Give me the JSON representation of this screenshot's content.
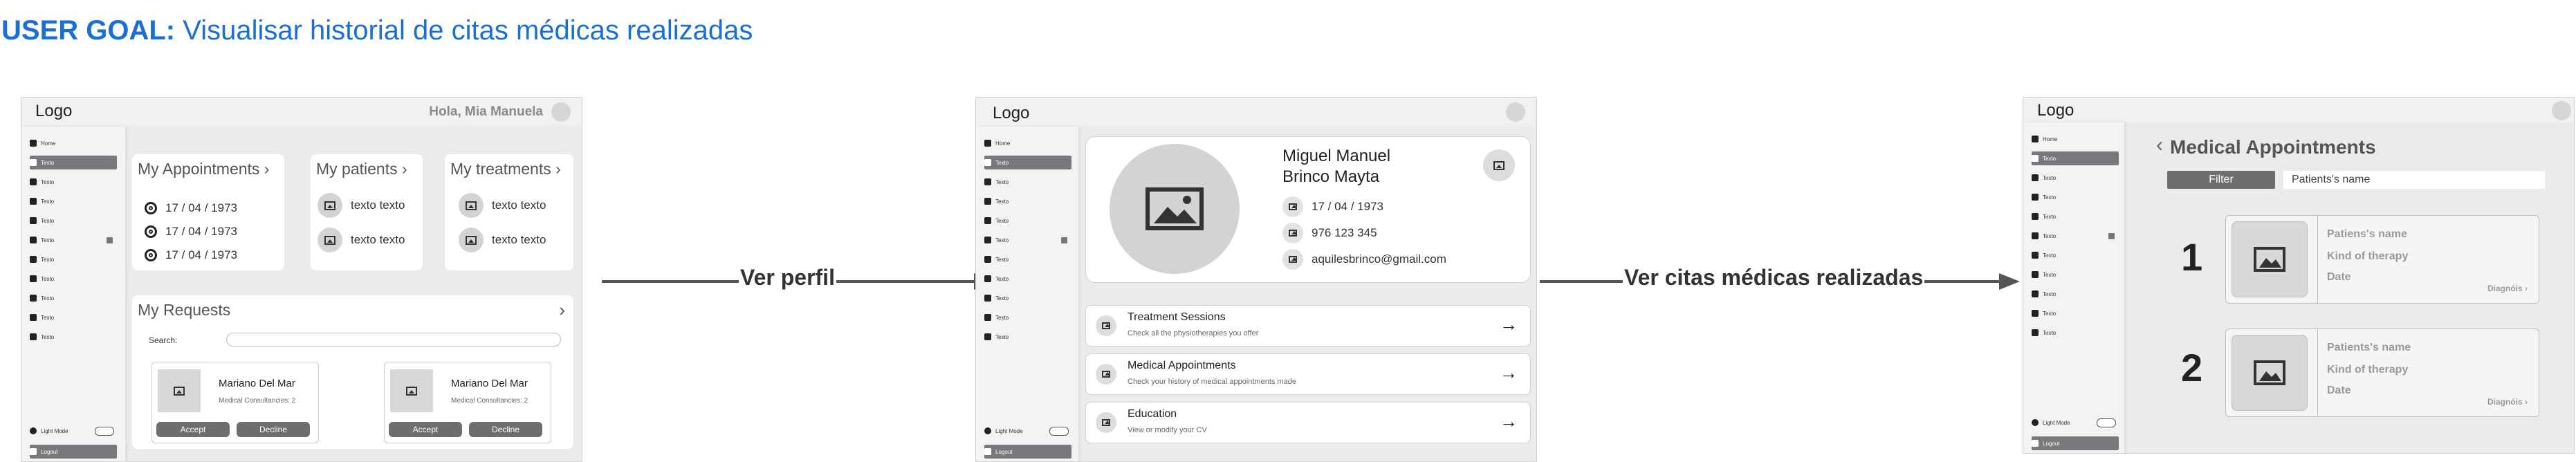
{
  "goal": {
    "prefix": "USER GOAL:",
    "text": "Visualisar historial de citas médicas realizadas"
  },
  "sidebar_generic": {
    "item_label": "Texto",
    "first_label": "Home",
    "lightmode": "Light Mode",
    "logout": "Logout"
  },
  "screen1": {
    "logo": "Logo",
    "greeting": "Hola, Mia Manuela",
    "appointments": {
      "title": "My Appointments ›",
      "dates": [
        "17 / 04 / 1973",
        "17 / 04 / 1973",
        "17 / 04 / 1973"
      ]
    },
    "patients": {
      "title": "My patients ›",
      "items": [
        "texto texto",
        "texto texto"
      ]
    },
    "treatments": {
      "title": "My treatments ›",
      "items": [
        "texto texto",
        "texto texto"
      ]
    },
    "requests": {
      "title": "My Requests",
      "chevron": "›",
      "search_label": "Search:",
      "cards": [
        {
          "name": "Mariano Del Mar",
          "sub": "Medical Consultancies: 2",
          "accept": "Accept",
          "decline": "Decline"
        },
        {
          "name": "Mariano Del Mar",
          "sub": "Medical Consultancies: 2",
          "accept": "Accept",
          "decline": "Decline"
        }
      ]
    }
  },
  "arrow1": {
    "label": "Ver perfil"
  },
  "screen2": {
    "logo": "Logo",
    "profile": {
      "name_line1": "Miguel Manuel",
      "name_line2": "Brinco Mayta",
      "birthdate": "17 / 04 / 1973",
      "phone": "976 123 345",
      "email": "aquilesbrinco@gmail.com"
    },
    "sections": [
      {
        "title": "Treatment Sessions",
        "sub": "Check all the physiotherapies you offer",
        "arrow": "→"
      },
      {
        "title": "Medical Appointments",
        "sub": "Check your history of medical appointments made",
        "arrow": "→"
      },
      {
        "title": "Education",
        "sub": "View or modify your CV",
        "arrow": "→"
      }
    ]
  },
  "arrow2": {
    "label": "Ver citas médicas realizadas"
  },
  "screen3": {
    "logo": "Logo",
    "back": "‹",
    "title": "Medical Appointments",
    "filter_label": "Filter",
    "filter_placeholder": "Patients's name",
    "appointments": [
      {
        "number": "1",
        "name": "Patiens's name",
        "therapy": "Kind of therapy",
        "date": "Date",
        "link": "Diagnóis ›"
      },
      {
        "number": "2",
        "name": "Patients's name",
        "therapy": "Kind of therapy",
        "date": "Date",
        "link": "Diagnóis ›"
      }
    ]
  }
}
